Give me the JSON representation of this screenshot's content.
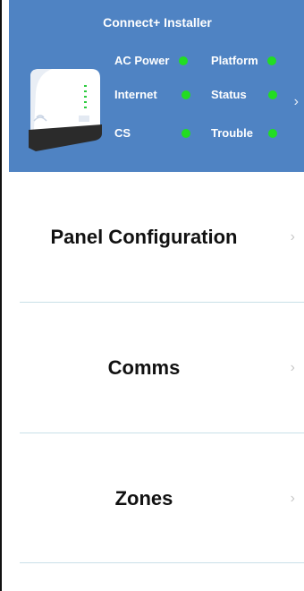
{
  "header": {
    "title": "Connect+ Installer",
    "chevron": "›",
    "device_icon": "panel-device-icon",
    "statuses": [
      {
        "label": "AC Power",
        "color": "#22dd22"
      },
      {
        "label": "Platform",
        "color": "#22dd22"
      },
      {
        "label": "Internet",
        "color": "#22dd22"
      },
      {
        "label": "Status",
        "color": "#22dd22"
      },
      {
        "label": "CS",
        "color": "#22dd22"
      },
      {
        "label": "Trouble",
        "color": "#22dd22"
      }
    ]
  },
  "menu": {
    "items": [
      {
        "label": "Panel Configuration",
        "chevron": "›"
      },
      {
        "label": "Comms",
        "chevron": "›"
      },
      {
        "label": "Zones",
        "chevron": "›"
      }
    ]
  },
  "colors": {
    "header_bg": "#4f83c3",
    "status_ok": "#22dd22",
    "divider": "#c9e0e8",
    "chevron": "#c8c8c8"
  }
}
